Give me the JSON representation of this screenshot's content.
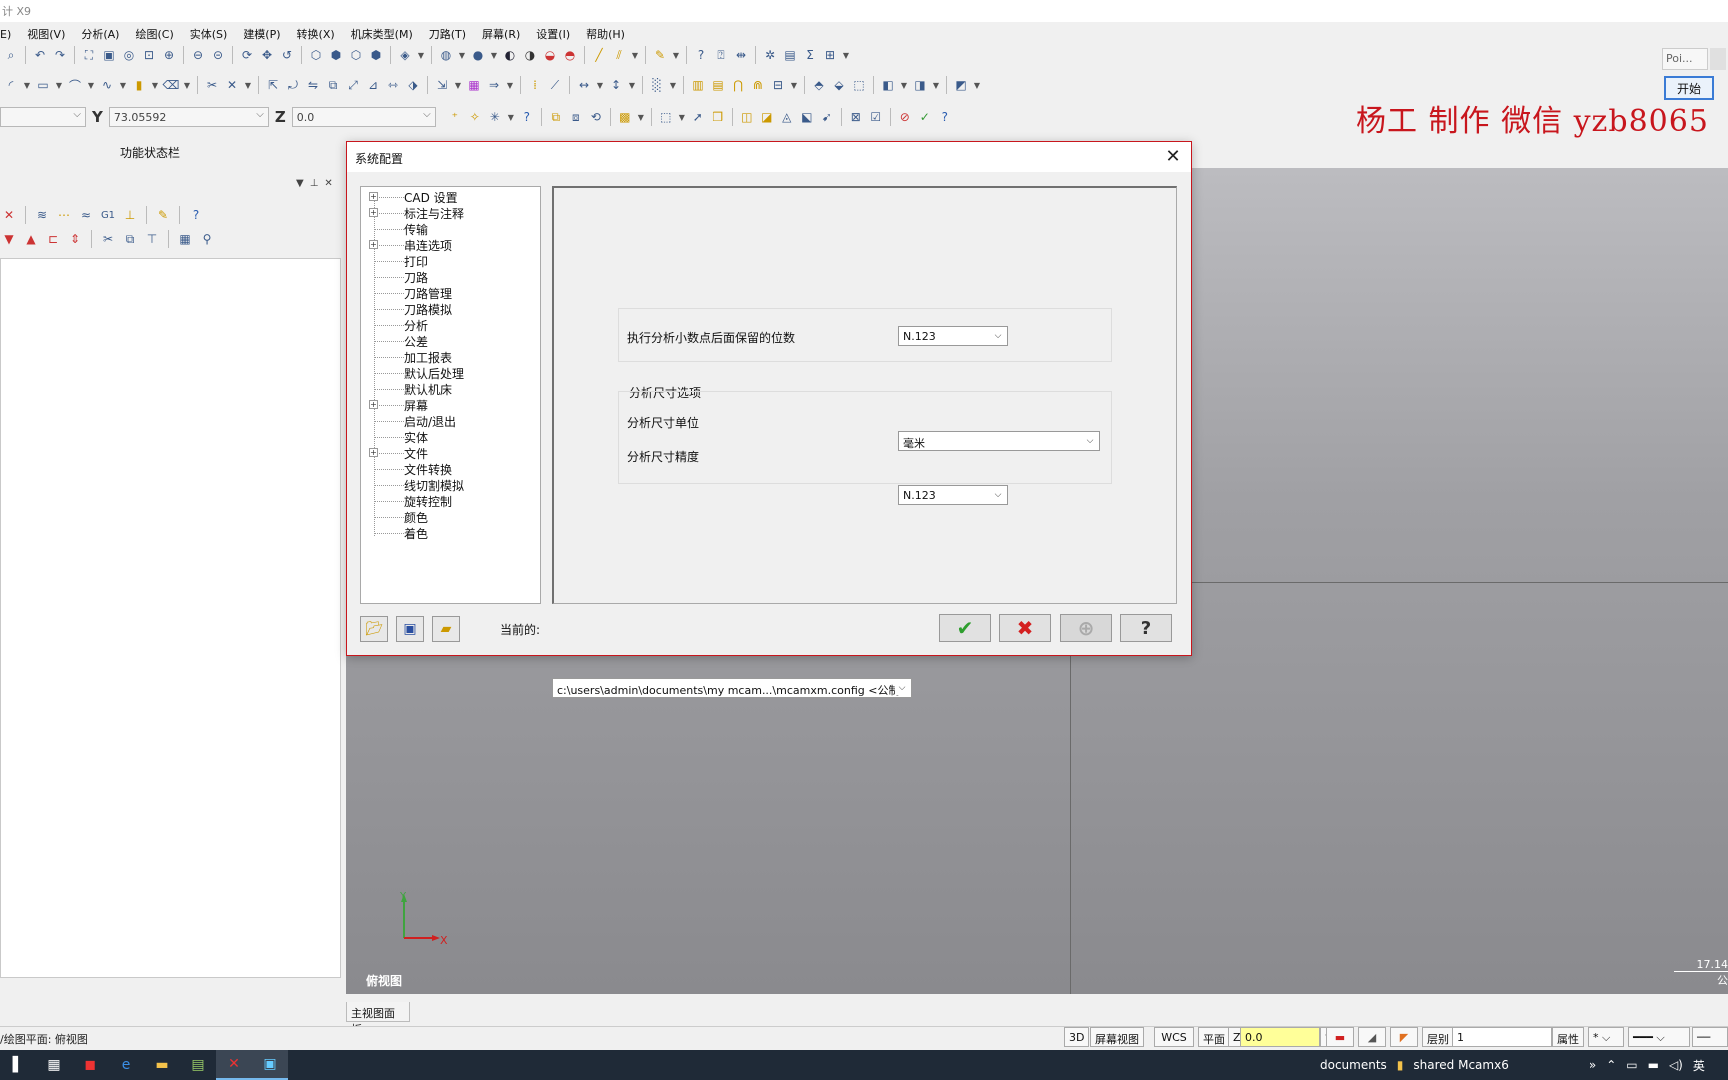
{
  "app": {
    "title_fragment": "计 X9"
  },
  "menu": [
    "E)",
    "视图(V)",
    "分析(A)",
    "绘图(C)",
    "实体(S)",
    "建模(P)",
    "转换(X)",
    "机床类型(M)",
    "刀路(T)",
    "屏幕(R)",
    "设置(I)",
    "帮助(H)"
  ],
  "coords": {
    "y_label": "Y",
    "y_value": "73.05592",
    "z_label": "Z",
    "z_value": "0.0"
  },
  "left_panel": {
    "title": "功能状态栏"
  },
  "top_right": {
    "poi_text": "Poi...",
    "start_label": "开始"
  },
  "watermark": "杨工 制作 微信 yzb8065",
  "dialog": {
    "title": "系统配置",
    "tree": [
      {
        "label": "CAD 设置",
        "expandable": true
      },
      {
        "label": "标注与注释",
        "expandable": true
      },
      {
        "label": "传输",
        "expandable": false
      },
      {
        "label": "串连选项",
        "expandable": true
      },
      {
        "label": "打印",
        "expandable": false
      },
      {
        "label": "刀路",
        "expandable": false
      },
      {
        "label": "刀路管理",
        "expandable": false
      },
      {
        "label": "刀路模拟",
        "expandable": false
      },
      {
        "label": "分析",
        "expandable": false
      },
      {
        "label": "公差",
        "expandable": false
      },
      {
        "label": "加工报表",
        "expandable": false
      },
      {
        "label": "默认后处理",
        "expandable": false
      },
      {
        "label": "默认机床",
        "expandable": false
      },
      {
        "label": "屏幕",
        "expandable": true
      },
      {
        "label": "启动/退出",
        "expandable": false
      },
      {
        "label": "实体",
        "expandable": false
      },
      {
        "label": "文件",
        "expandable": true
      },
      {
        "label": "文件转换",
        "expandable": false
      },
      {
        "label": "线切割模拟",
        "expandable": false
      },
      {
        "label": "旋转控制",
        "expandable": false
      },
      {
        "label": "颜色",
        "expandable": false
      },
      {
        "label": "着色",
        "expandable": false
      }
    ],
    "decimal_label": "执行分析小数点后面保留的位数",
    "decimal_value": "N.123",
    "dim_group_title": "分析尺寸选项",
    "unit_label": "分析尺寸单位",
    "unit_value": "毫米",
    "precision_label": "分析尺寸精度",
    "precision_value": "N.123",
    "current_label": "当前的:",
    "current_path": "c:\\users\\admin\\documents\\my mcam...\\mcamxm.config <公制> <启动"
  },
  "viewport": {
    "view_name": "俯视图",
    "scale_value": "17.14",
    "scale_unit": "公",
    "axis_x": "X",
    "axis_y": "Y"
  },
  "view_tab": "主视图面板",
  "status": {
    "text": "/绘图平面: 俯视图",
    "mode_3d": "3D",
    "screen_view": "屏幕视图",
    "wcs": "WCS",
    "plane": "平面",
    "z_label": "Z",
    "z_value": "0.0",
    "level_label": "层别",
    "level_value": "1",
    "attr_label": "属性"
  },
  "taskbar": {
    "tray_docs": "documents",
    "tray_folder": "shared Mcamx6",
    "lang": "英"
  },
  "colors": {
    "accent": "#c8161d",
    "start_border": "#3a7bd5",
    "ok": "#2e9e2e",
    "cancel": "#d42020"
  }
}
